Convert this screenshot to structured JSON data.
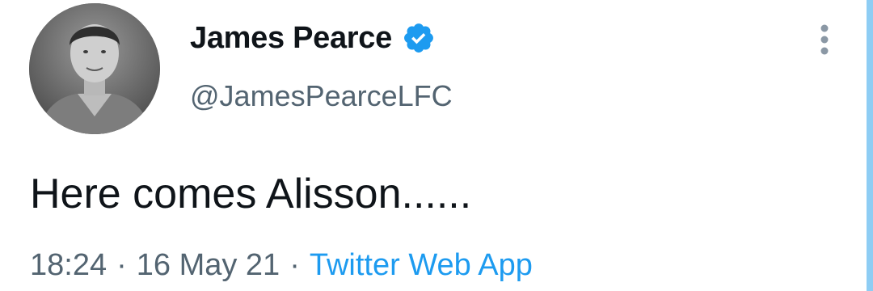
{
  "tweet": {
    "display_name": "James Pearce",
    "handle": "@JamesPearceLFC",
    "verified": true,
    "text": "Here comes Alisson......",
    "time": "18:24",
    "date": "16 May 21",
    "source": "Twitter Web App",
    "separator": "·"
  },
  "icons": {
    "avatar": "profile-photo",
    "verified": "verified-badge-icon",
    "more": "more-vertical-icon"
  },
  "colors": {
    "name": "#0f1419",
    "secondary": "#536471",
    "link": "#1d9bf0",
    "verified": "#1d9bf0",
    "accent_bar": "#8ecdf4"
  }
}
